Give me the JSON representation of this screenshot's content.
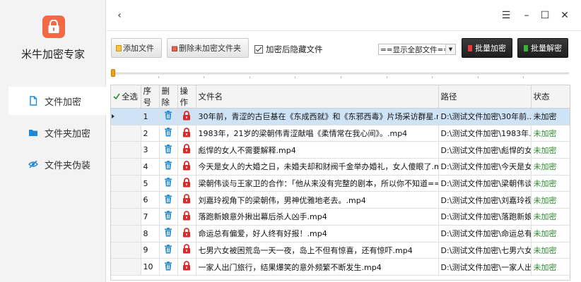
{
  "app": {
    "title": "米牛加密专家"
  },
  "sidebar": {
    "items": [
      {
        "label": "文件加密",
        "icon": "file-icon",
        "active": true
      },
      {
        "label": "文件夹加密",
        "icon": "folder-icon",
        "active": false
      },
      {
        "label": "文件夹伪装",
        "icon": "eye-slash-icon",
        "active": false
      }
    ]
  },
  "titlebar": {
    "back": "‹",
    "menu": "☰",
    "minimize": "–",
    "maximize": "☐",
    "close": "✕"
  },
  "toolbar": {
    "add_file": "添加文件",
    "remove_unencrypted": "删除未加密文件夹",
    "hide_after_encrypt": "加密后隐藏文件",
    "hide_after_encrypt_checked": true,
    "filter_selected": "==显示全部文件==",
    "batch_encrypt": "批量加密",
    "batch_decrypt": "批量解密"
  },
  "colors": {
    "accent": "#f26a45",
    "danger": "#d9292b",
    "trash": "#1e88d8",
    "ok": "#2d8a2d",
    "selected": "#cfe3f7"
  },
  "progress": {
    "value": 0
  },
  "table": {
    "select_all": "全选",
    "columns": [
      "序号",
      "删除",
      "操作",
      "文件名",
      "路径",
      "状态"
    ],
    "rows": [
      {
        "no": "1",
        "name": "30年前，青涩的古巨基在《东成西就》和《东邪西毒》片场采访群星.mp4",
        "path": "D:\\测试文件加密\\30年前...",
        "status": "未加密",
        "encrypted": false
      },
      {
        "no": "2",
        "name": "1983年，21岁的梁朝伟青涩献唱《柔情常在我心间》。.mp4",
        "path": "D:\\测试文件加密\\1983年...",
        "status": "未加密",
        "encrypted": true
      },
      {
        "no": "3",
        "name": "彪悍的女人不需要解释.mp4",
        "path": "D:\\测试文件加密\\彪悍的女...",
        "status": "未加密",
        "encrypted": true
      },
      {
        "no": "4",
        "name": "今天是女人的大婚之日，未婚夫却和财阀千金举办婚礼，女人傻眼了.mp4",
        "path": "D:\\测试文件加密\\今天是女...",
        "status": "未加密",
        "encrypted": true
      },
      {
        "no": "5",
        "name": "梁朝伟谈与王家卫的合作：「他从来没有完整的剧本，所以你不知道==.m",
        "path": "D:\\测试文件加密\\梁朝伟谈...",
        "status": "未加密",
        "encrypted": true
      },
      {
        "no": "6",
        "name": "刘嘉玲视角下的梁朝伟，男神优雅地老去。.mp4",
        "path": "D:\\测试文件加密\\刘嘉玲视...",
        "status": "未加密",
        "encrypted": true
      },
      {
        "no": "7",
        "name": "落跑新娘意外揪出幕后杀人凶手.mp4",
        "path": "D:\\测试文件加密\\落跑新娘...",
        "status": "未加密",
        "encrypted": true
      },
      {
        "no": "8",
        "name": "命运总有偏爱，好人终有好报！.mp4",
        "path": "D:\\测试文件加密\\命运总有...",
        "status": "未加密",
        "encrypted": true
      },
      {
        "no": "9",
        "name": "七男六女被困荒岛一天一夜，岛上不但有惊喜，还有惊吓.mp4",
        "path": "D:\\测试文件加密\\七男六女...",
        "status": "未加密",
        "encrypted": true
      },
      {
        "no": "10",
        "name": "一家人出门旅行，结果爆笑的意外频繁不断发生.mp4",
        "path": "D:\\测试文件加密\\一家人出...",
        "status": "未加密",
        "encrypted": true
      }
    ]
  }
}
